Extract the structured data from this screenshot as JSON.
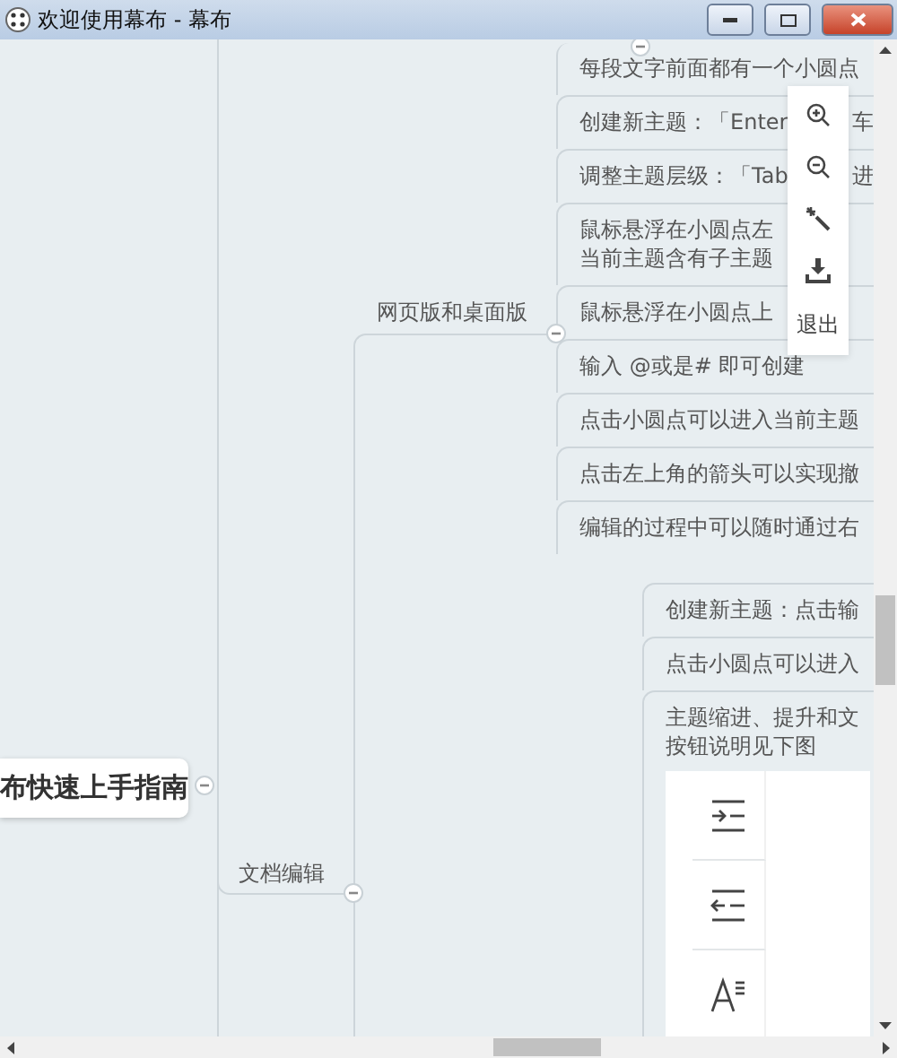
{
  "window": {
    "title": "欢迎使用幕布 - 幕布"
  },
  "root": {
    "label": "布快速上手指南",
    "expanded": true
  },
  "branch": {
    "label": "文档编辑",
    "expanded": true
  },
  "sub_branch": {
    "label": "网页版和桌面版",
    "expanded": true
  },
  "group_1_items": [
    {
      "lines": [
        "每段文字前面都有一个小圆点"
      ]
    },
    {
      "lines": [
        "创建新主题：「Enter"
      ],
      "tail": "车"
    },
    {
      "lines": [
        "调整主题层级：「Tab"
      ],
      "tail": "进"
    },
    {
      "lines": [
        "鼠标悬浮在小圆点左",
        "当前主题含有子主题"
      ]
    },
    {
      "lines": [
        "鼠标悬浮在小圆点上"
      ]
    },
    {
      "lines": [
        "输入 @或是# 即可创建"
      ]
    },
    {
      "lines": [
        "点击小圆点可以进入当前主题"
      ]
    },
    {
      "lines": [
        "点击左上角的箭头可以实现撤"
      ]
    },
    {
      "lines": [
        "编辑的过程中可以随时通过右"
      ]
    }
  ],
  "group_2_items": [
    {
      "kind": "text",
      "lines": [
        "创建新主题：点击输"
      ]
    },
    {
      "kind": "text",
      "lines": [
        "点击小圆点可以进入"
      ]
    },
    {
      "kind": "figure",
      "lines": [
        "主题缩进、提升和文",
        "按钮说明见下图"
      ]
    }
  ],
  "toolbar": {
    "exit_label": "退出"
  }
}
